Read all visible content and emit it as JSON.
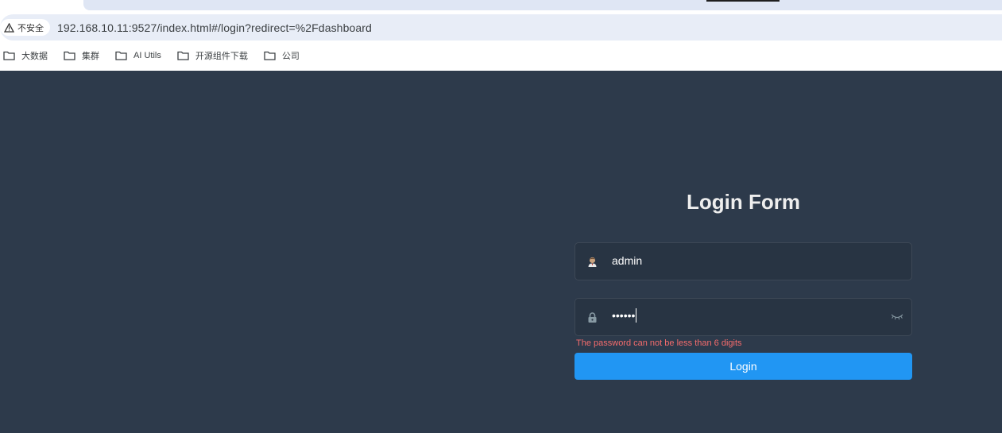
{
  "browser": {
    "security_label": "不安全",
    "url": "192.168.10.11:9527/index.html#/login?redirect=%2Fdashboard",
    "bookmarks": [
      "大数据",
      "集群",
      "AI Utils",
      "开源组件下载",
      "公司"
    ]
  },
  "login": {
    "title": "Login Form",
    "username_value": "admin",
    "password_mask": "••••••",
    "error": "The password can not be less than 6 digits",
    "button_label": "Login"
  },
  "colors": {
    "page_bg": "#2d3a4b",
    "input_bg": "#283443",
    "button": "#2196f3",
    "error": "#f56c6c"
  },
  "icons": [
    "warning-icon",
    "folder-icon",
    "user-icon",
    "lock-icon",
    "eye-closed-icon"
  ]
}
